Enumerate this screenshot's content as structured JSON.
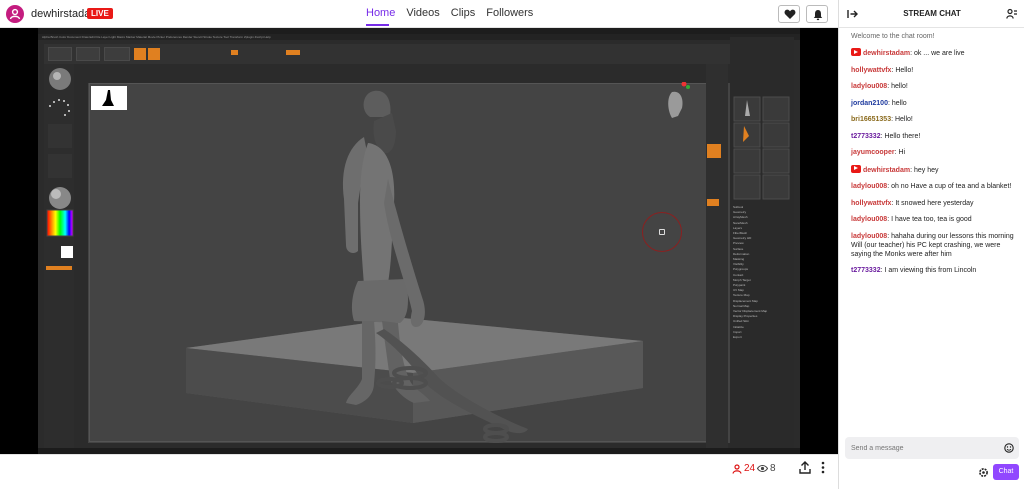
{
  "channel": {
    "name": "dewhirstadam",
    "live_label": "LIVE"
  },
  "nav": {
    "tabs": [
      {
        "label": "Home",
        "active": true
      },
      {
        "label": "Videos",
        "active": false
      },
      {
        "label": "Clips",
        "active": false
      },
      {
        "label": "Followers",
        "active": false
      }
    ]
  },
  "stream": {
    "app_menu": "Alpha  Brush  Color  Document  Draw  Edit  File  Layer  Light  Macro  Marker  Material  Movie  Picker  Preferences  Render  Stencil  Stroke  Texture  Tool  Transform  Zplugin  Zscript  Help",
    "tool_list": [
      "Subtool",
      "Geometry",
      "ArrayMesh",
      "NanoMesh",
      "Layers",
      "FiberMesh",
      "Geometry HD",
      "Preview",
      "Surface",
      "Deformation",
      "Masking",
      "Visibility",
      "Polygroups",
      "Contact",
      "Morph Target",
      "Polypaint",
      "UV Map",
      "Texture Map",
      "Displacement Map",
      "Normal Map",
      "Vector Displacement Map",
      "Display Properties",
      "Unified Skin",
      "Initialize",
      "Import",
      "Export"
    ]
  },
  "stats": {
    "viewers": "24",
    "watching": "8"
  },
  "chat": {
    "title": "STREAM CHAT",
    "welcome": "Welcome to the chat room!",
    "input_placeholder": "Send a message",
    "send_label": "Chat",
    "messages": [
      {
        "user": "dewhirstadam",
        "text": "ok ... we are live",
        "badge": true,
        "color": "#c83939"
      },
      {
        "user": "hollywattvfx",
        "text": "Hello!",
        "badge": false,
        "color": "#c83939"
      },
      {
        "user": "ladylou008",
        "text": "hello!",
        "badge": false,
        "color": "#c83939"
      },
      {
        "user": "jordan2100",
        "text": "hello",
        "badge": false,
        "color": "#1e3a9e"
      },
      {
        "user": "bri16651353",
        "text": "Hello!",
        "badge": false,
        "color": "#8a6a1c"
      },
      {
        "user": "t2773332",
        "text": "Hello there!",
        "badge": false,
        "color": "#6a1c9e"
      },
      {
        "user": "jayumcooper",
        "text": "Hi",
        "badge": false,
        "color": "#c83939"
      },
      {
        "user": "dewhirstadam",
        "text": "hey hey",
        "badge": true,
        "color": "#c83939"
      },
      {
        "user": "ladylou008",
        "text": "oh no Have a cup of tea and a blanket!",
        "badge": false,
        "color": "#c83939"
      },
      {
        "user": "hollywattvfx",
        "text": "It snowed here yesterday",
        "badge": false,
        "color": "#c83939"
      },
      {
        "user": "ladylou008",
        "text": "I have tea too, tea is good",
        "badge": false,
        "color": "#c83939"
      },
      {
        "user": "ladylou008",
        "text": "hahaha during our lessons this morning Will (our teacher) his PC kept crashing, we were saying the Monks were after him",
        "badge": false,
        "color": "#c83939"
      },
      {
        "user": "t2773332",
        "text": "I am viewing this from Lincoln",
        "badge": false,
        "color": "#6a1c9e"
      }
    ]
  }
}
